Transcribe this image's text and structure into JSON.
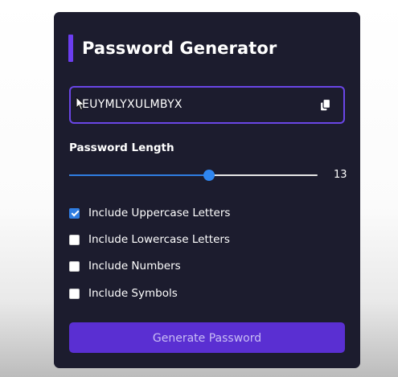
{
  "app": {
    "title": "Password Generator"
  },
  "password_field": {
    "value": "EUYMLYXULMBYX",
    "copy_icon": "copy-icon"
  },
  "length": {
    "label": "Password Length",
    "value": "13",
    "min": 4,
    "max": 20
  },
  "options": [
    {
      "label": "Include Uppercase Letters",
      "checked": true
    },
    {
      "label": "Include Lowercase Letters",
      "checked": false
    },
    {
      "label": "Include Numbers",
      "checked": false
    },
    {
      "label": "Include Symbols",
      "checked": false
    }
  ],
  "generate_button": {
    "label": "Generate Password"
  },
  "colors": {
    "card_background": "#1c1c2e",
    "accent": "#6c3df0",
    "button": "#5a2fd2",
    "slider": "#2f7de1"
  }
}
